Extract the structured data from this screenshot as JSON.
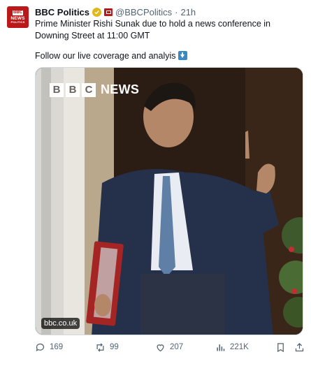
{
  "tweet": {
    "avatar_label": {
      "line1": "BBC",
      "line2": "NEWS",
      "line3": "POLITICS"
    },
    "author_name": "BBC Politics",
    "handle": "@BBCPolitics",
    "separator": "·",
    "timestamp": "21h",
    "text_line1": "Prime Minister Rishi Sunak due to hold a news conference in Downing Street at 11:00 GMT",
    "text_line2": "Follow our live coverage and analyis",
    "media": {
      "watermark_letters": [
        "B",
        "B",
        "C"
      ],
      "watermark_word": "NEWS",
      "source_badge": "bbc.co.uk"
    },
    "actions": {
      "replies": "169",
      "retweets": "99",
      "likes": "207",
      "views": "221K"
    },
    "colors": {
      "brand_red": "#bb1919",
      "verified_gold": "#e2b719",
      "secondary_text": "#536471"
    }
  }
}
